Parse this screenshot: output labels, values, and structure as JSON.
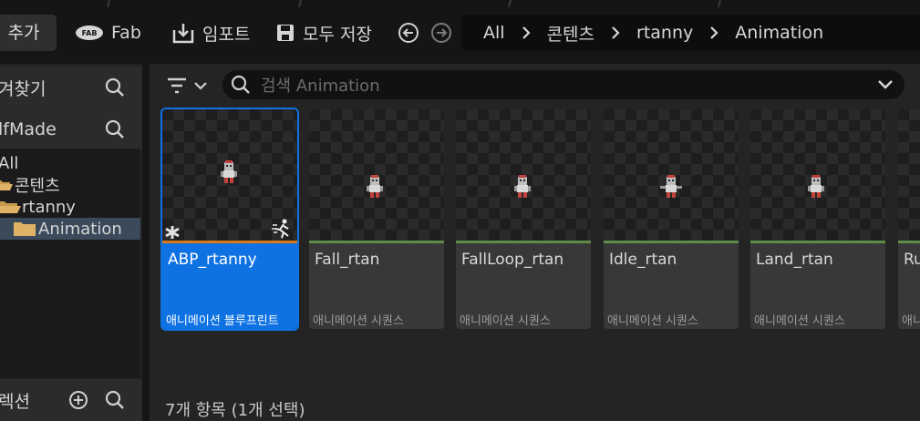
{
  "toolbar": {
    "add_label": "추가",
    "fab_label": "Fab",
    "import_label": "임포트",
    "save_all_label": "모두 저장"
  },
  "breadcrumb": {
    "items": [
      "All",
      "콘텐츠",
      "rtanny",
      "Animation"
    ]
  },
  "left_panel": {
    "favorites_header": "겨찾기",
    "project_header": "lfMade",
    "tree": [
      {
        "label": "All"
      },
      {
        "label": "콘텐츠"
      },
      {
        "label": "rtanny"
      },
      {
        "label": "Animation"
      }
    ],
    "collections_header": "렉션"
  },
  "search": {
    "placeholder": "검색 Animation"
  },
  "assets": [
    {
      "name": "ABP_rtanny",
      "type": "애니메이션 블루프린트",
      "selected": true
    },
    {
      "name": "Fall_rtan",
      "type": "애니메이션 시퀀스"
    },
    {
      "name": "FallLoop_rtan",
      "type": "애니메이션 시퀀스"
    },
    {
      "name": "Idle_rtan",
      "type": "애니메이션 시퀀스"
    },
    {
      "name": "Land_rtan",
      "type": "애니메이션 시퀀스"
    },
    {
      "name": "Ru",
      "type": "애니"
    }
  ],
  "status": {
    "count_label": "7개 항목 (1개 선택)"
  },
  "colors": {
    "selection": "#0e72e3",
    "blueprint_bar": "#d97a16",
    "sequence_bar": "#5f8d49"
  }
}
